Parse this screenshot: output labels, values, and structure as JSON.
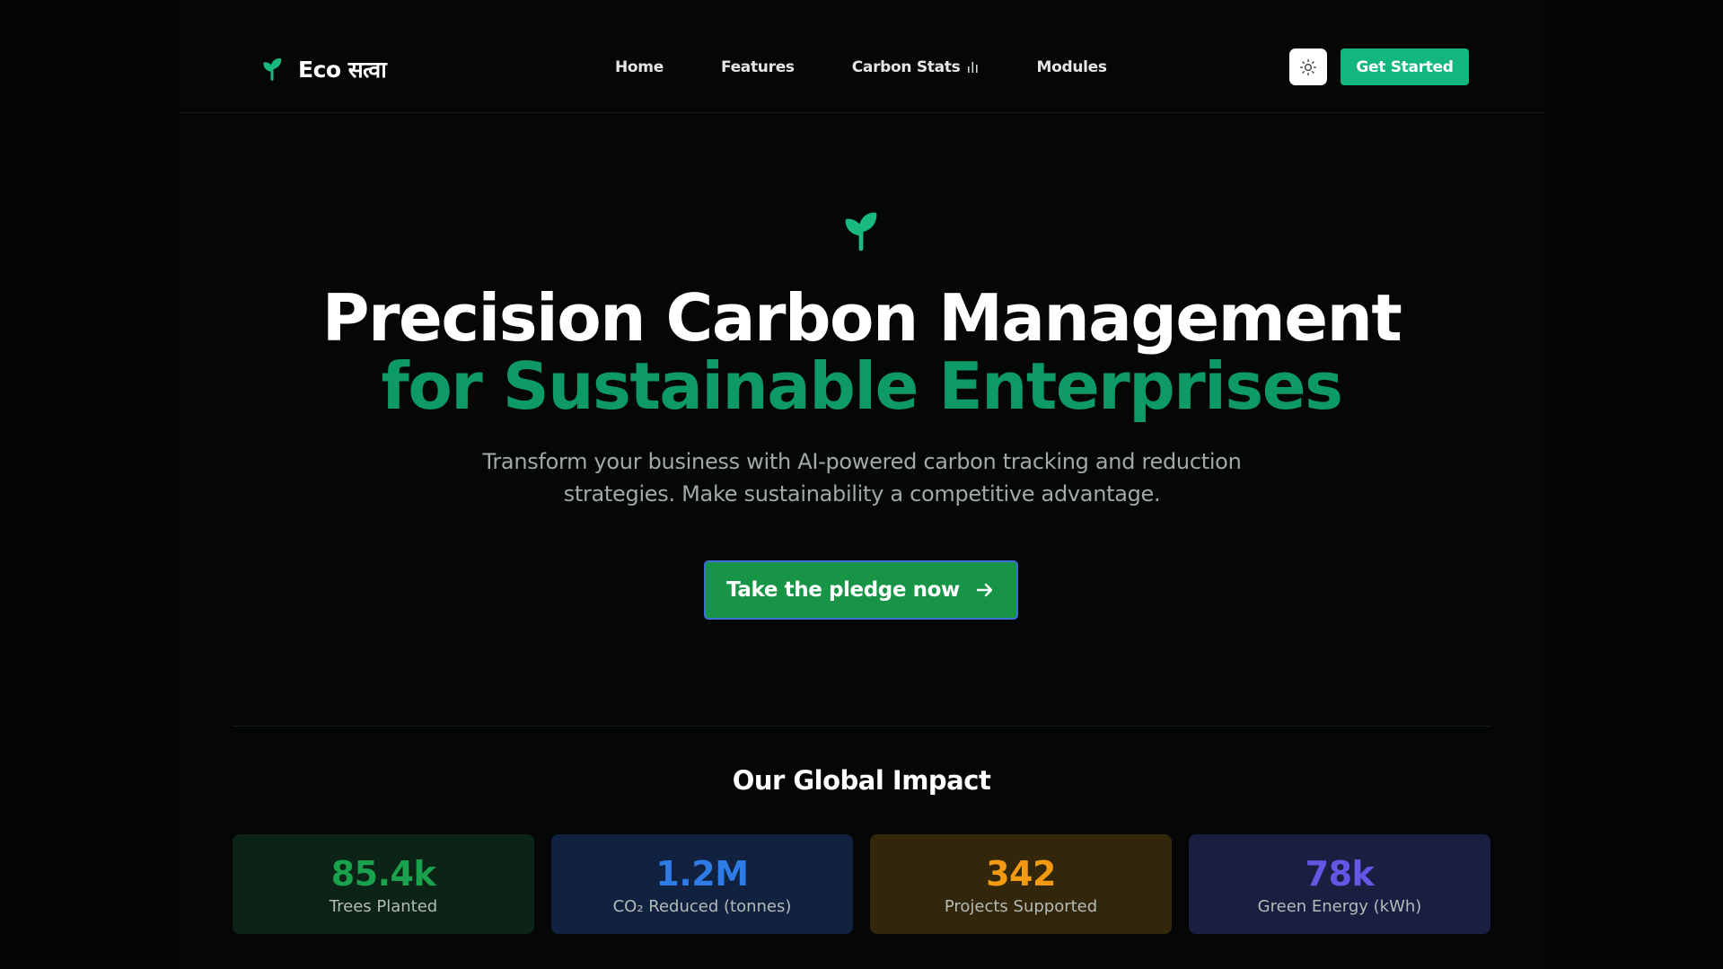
{
  "nav": {
    "brand": "Eco सत्वा",
    "links": [
      "Home",
      "Features",
      "Carbon Stats",
      "Modules"
    ],
    "theme_toggle_icon": "sun-icon",
    "get_started": "Get Started"
  },
  "hero": {
    "icon": "sprout-icon",
    "title_line1": "Precision Carbon Management",
    "title_line2": "for Sustainable Enterprises",
    "subtitle": "Transform your business with AI-powered carbon tracking and reduction strategies. Make sustainability a competitive advantage.",
    "cta_label": "Take the pledge now",
    "cta_icon": "arrow-right-icon"
  },
  "impact": {
    "title": "Our Global Impact",
    "stats": [
      {
        "value": "85.4k",
        "label": "Trees Planted",
        "color": "#1aa14e",
        "bg": "#0b2416"
      },
      {
        "value": "1.2M",
        "label": "CO₂ Reduced (tonnes)",
        "color": "#2f7be6",
        "bg": "#102240"
      },
      {
        "value": "342",
        "label": "Projects Supported",
        "color": "#f29a12",
        "bg": "#33270b"
      },
      {
        "value": "78k",
        "label": "Green Energy (kWh)",
        "color": "#6656e6",
        "bg": "#1a1e41"
      }
    ]
  },
  "colors": {
    "accent": "#13b67e",
    "title_green": "#0e9a67",
    "cta_bg": "#179445"
  }
}
